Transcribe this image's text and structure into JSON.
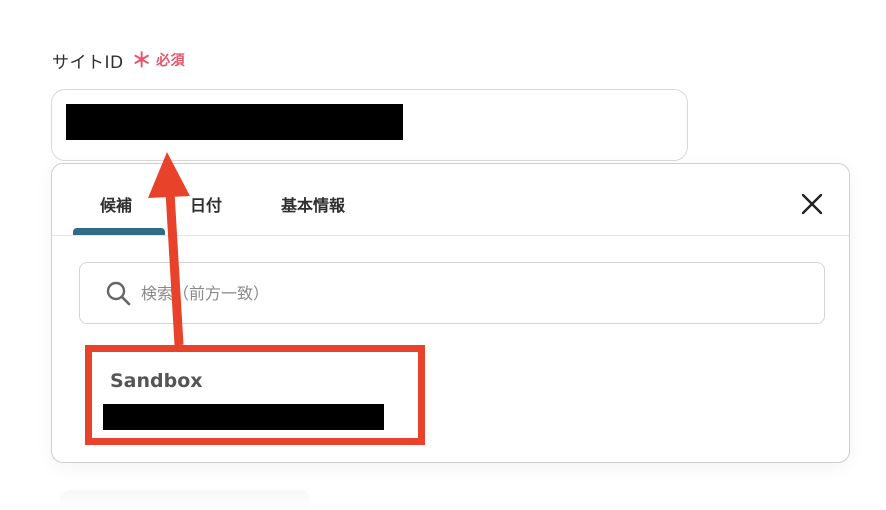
{
  "field": {
    "label": "サイトID",
    "required_star": "＊",
    "required_text": "必須"
  },
  "dropdown": {
    "tabs": [
      {
        "label": "候補",
        "active": true
      },
      {
        "label": "日付",
        "active": false
      },
      {
        "label": "基本情報",
        "active": false
      }
    ],
    "close_icon": "close-icon",
    "search": {
      "placeholder": "検索（前方一致）",
      "icon": "search-icon",
      "value": ""
    },
    "options": [
      {
        "label": "Sandbox"
      }
    ]
  },
  "colors": {
    "required": "#e5566a",
    "tab_indicator": "#2f6b87",
    "annotation": "#e8432a",
    "border": "#d8d8d8"
  }
}
